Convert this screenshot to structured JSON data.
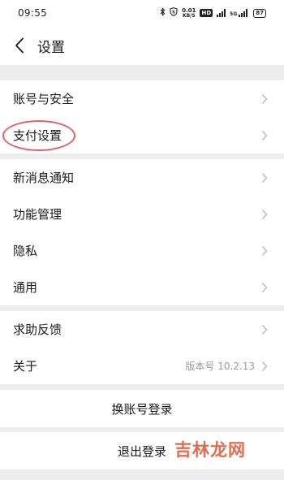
{
  "status_bar": {
    "time": "09:55",
    "speed_top": "0.01",
    "speed_bottom": "KB/S",
    "hd": "HD",
    "net": "5G",
    "battery": "87"
  },
  "header": {
    "title": "设置"
  },
  "group1": [
    {
      "label": "账号与安全"
    },
    {
      "label": "支付设置"
    }
  ],
  "group2": [
    {
      "label": "新消息通知"
    },
    {
      "label": "功能管理"
    },
    {
      "label": "隐私"
    },
    {
      "label": "通用"
    }
  ],
  "group3": [
    {
      "label": "求助反馈"
    },
    {
      "label": "关于",
      "value": "版本号 10.2.13"
    }
  ],
  "switch_account": "换账号登录",
  "logout": "退出登录",
  "watermark": "吉林龙网"
}
